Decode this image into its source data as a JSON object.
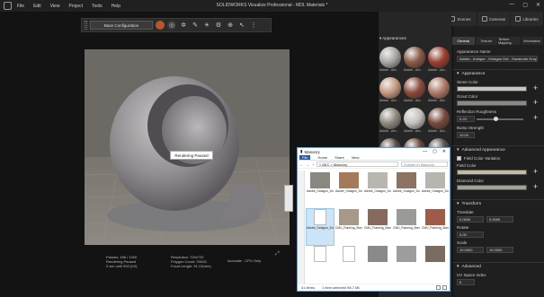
{
  "menu": {
    "items": [
      "File",
      "Edit",
      "View",
      "Project",
      "Tools",
      "Help"
    ],
    "title": "SOLIDWORKS Visualize Professional - MDL Materials *",
    "controls": [
      "—",
      "▢",
      "✕"
    ]
  },
  "viewport_toolbar": {
    "configuration": "Base Configuration"
  },
  "viewport": {
    "paused_label": "Rendering Paused",
    "stats_left": [
      "Passes: 496 / 1000",
      "Rendering Paused",
      "0 sec until 500 (0X)"
    ],
    "stats_mid": [
      "Resolution: 720x720",
      "Polygon Count: 20028",
      "Focal Length: 91.13(mm)"
    ],
    "mode": "Accurate - CPU Only"
  },
  "palette_tabs": [
    "Models",
    "Appearances",
    "Scenes",
    "Cameras",
    "Libraries"
  ],
  "appearances": {
    "header": "Appearances",
    "swatches": [
      {
        "label": "Adobe - Ant...",
        "color": "#a9a7a2"
      },
      {
        "label": "Adobe - Ant...",
        "color": "#8c5a45"
      },
      {
        "label": "Adobe - Ant...",
        "color": "#9a3f2e"
      },
      {
        "label": "Adobe - Ant...",
        "color": "#c59a7e"
      },
      {
        "label": "Adobe - Ant...",
        "color": "#8d4b3a"
      },
      {
        "label": "Adobe - Ant...",
        "color": "#b07a66"
      },
      {
        "label": "Adobe - Ant...",
        "color": "#8f8a7e"
      },
      {
        "label": "Adobe - Ant...",
        "color": "#c4c0bc"
      },
      {
        "label": "Adobe - Ant...",
        "color": "#7a4a3b"
      },
      {
        "label": "",
        "color": "#5a4a3e"
      },
      {
        "label": "",
        "color": "#6b4535"
      },
      {
        "label": "",
        "color": "#555046"
      }
    ]
  },
  "properties": {
    "tabs": [
      "General",
      "Texture",
      "Texture Mapping",
      "Information"
    ],
    "name_label": "Appearance Name",
    "name_value": "Adobe - Antique - Octagon Dot - Savannah Grays",
    "appearance_section": "Appearance",
    "stone_color_label": "Stone Color",
    "stone_color": "#c9c6bf",
    "grout_color_label": "Grout Color",
    "grout_color": "#8a8a84",
    "reflection_label": "Reflection Roughness",
    "reflection_value": "0.23",
    "reflection_level": 0.4,
    "bump_label": "Bump Strength",
    "bump_value": "10.00",
    "advanced_section": "Advanced Appearance",
    "field_variation_label": "Field Color Variation",
    "field_color_label": "Field Color",
    "field_color": "#c2bba0",
    "diamond_color_label": "Diamond Color",
    "diamond_color": "#a3a194",
    "transform_section": "Transform",
    "translate_label": "Translate",
    "translate_value": "0.0000",
    "translate_value2": "0.0000",
    "rotate_label": "Rotate",
    "rotate_value": "0.00",
    "scale_label": "Scale",
    "scale_value": "10.0000",
    "scale_value2": "10.0000",
    "advanced2_section": "Advanced",
    "uv_label": "UV Space Index",
    "uv_value": "0"
  },
  "explorer": {
    "title": "Masonry",
    "ribbon": [
      "File",
      "Home",
      "Share",
      "View"
    ],
    "breadcrumb": "« AEC > Masonry",
    "search_placeholder": "Zoeken in Masonry",
    "files": [
      "Adobe_Octagon_Dot_adobe_octagon_dot_mud",
      "Adobe_Octagon_Dot.adobe_octagon_dot_ochre_dot",
      "Adobe_Octagon_Dot.adobe_octagon_dot_savannah_grays",
      "Adobe_Octagon_Dot.adobe_octagon_dot_mix",
      "Adobe_Octagon_Dot.adobe_octagon_dot_savannah_grays",
      "Adobe_Octagon_Dot.mdl",
      "CMU_Running_Bond_Splitface.cmu_running_bond_splitface_beige",
      "CMU_Running_Bond_Splitface.cmu_running_bond_splitface_brown",
      "CMU_Running_Bond_Splitface.cmu_running_bond_splitface_gray",
      "CMU_Running_Bond_Splitface.cmu_running_bond_splitface_red",
      "",
      "",
      "",
      "",
      ""
    ],
    "file_colors": [
      "#8a8680",
      "#a57a5a",
      "#b9b6b0",
      "#8c7260",
      "#b8b4ae",
      "doc",
      "#a89888",
      "#876a5c",
      "#9a9a98",
      "#a05a4a",
      "doc",
      "doc",
      "#8a8a8a",
      "#9d9d9b",
      "#7a6b63"
    ],
    "status_count": "41 items",
    "status_sel": "1 item selected 98.7 kB"
  }
}
